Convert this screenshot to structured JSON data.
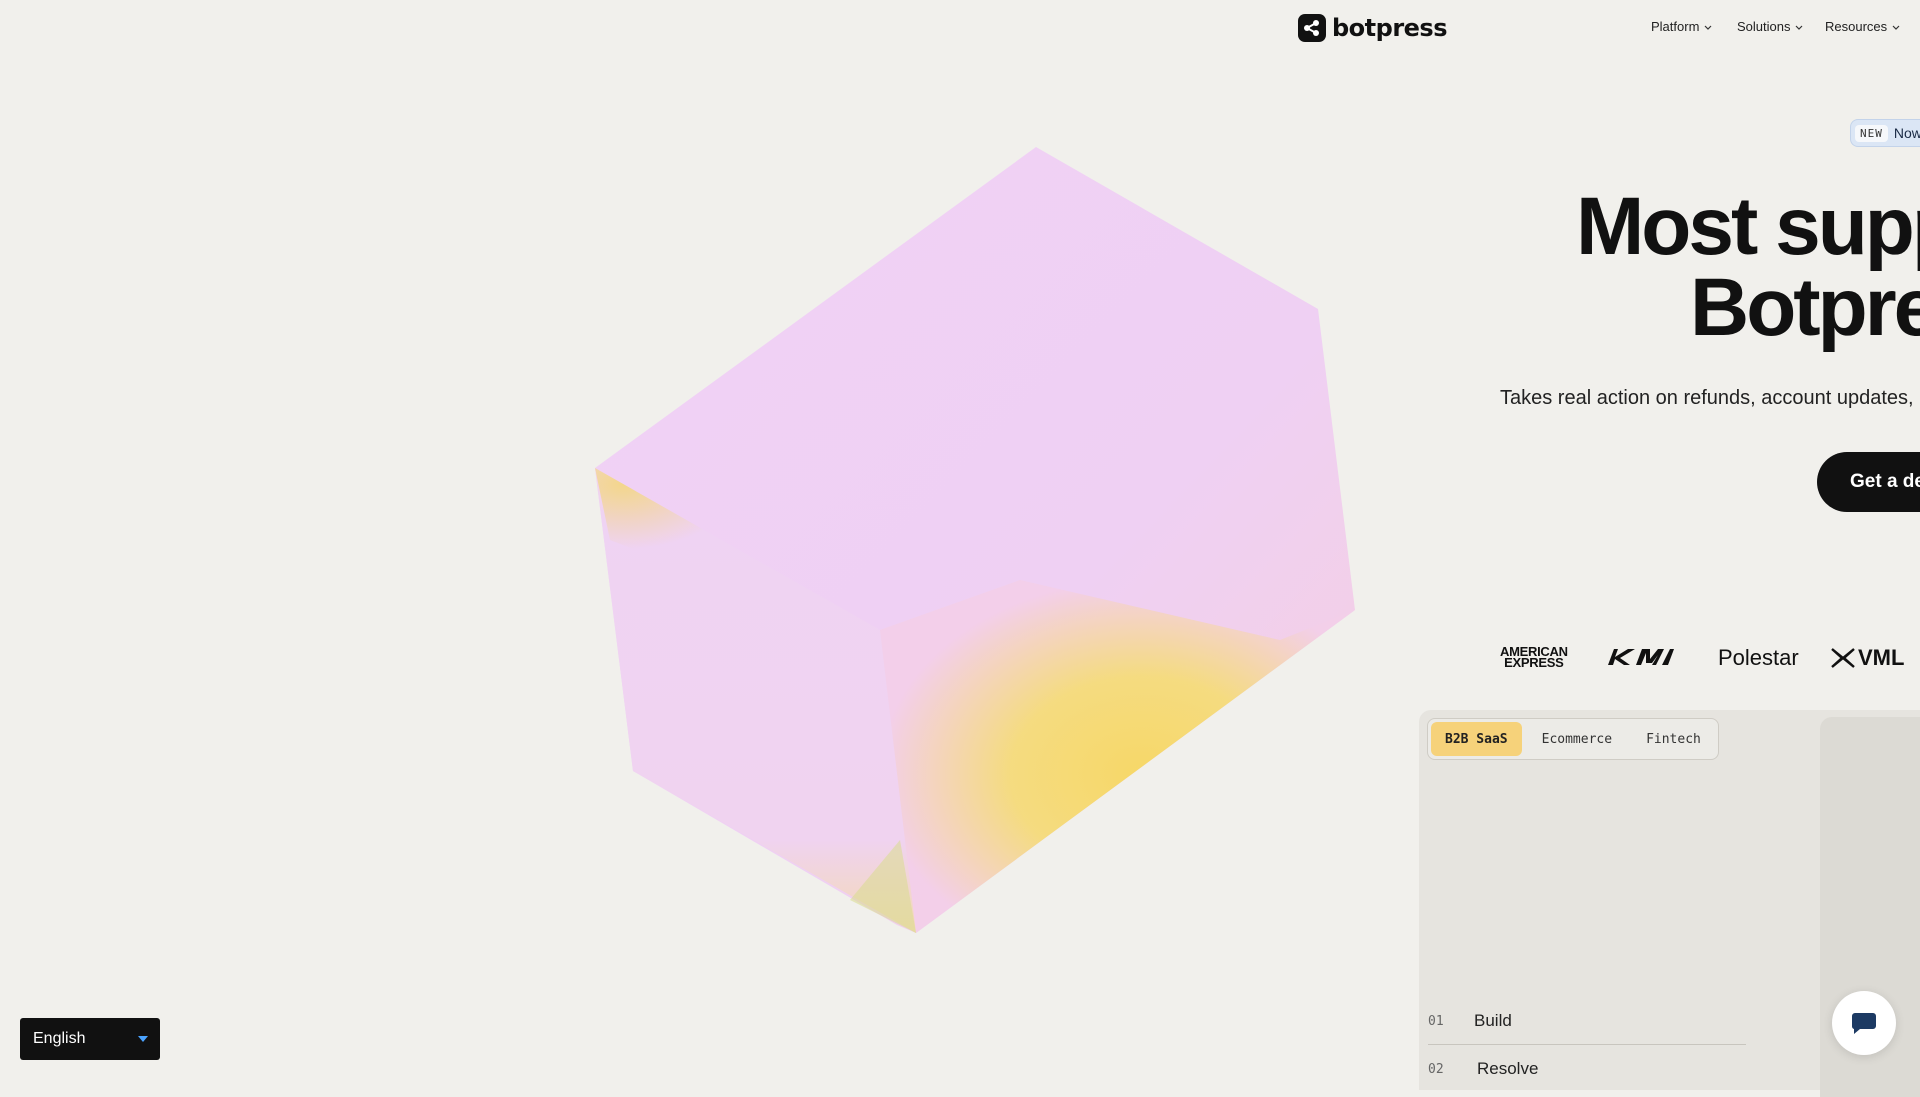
{
  "header": {
    "brand": "botpress",
    "nav": [
      {
        "label": "Platform"
      },
      {
        "label": "Solutions"
      },
      {
        "label": "Resources"
      }
    ]
  },
  "announcement": {
    "tag": "NEW",
    "text": "Now"
  },
  "hero": {
    "title_line1": "Most supp",
    "title_line2": "Botpre",
    "subtitle": "Takes real action on refunds, account updates, ar",
    "cta_label": "Get a de"
  },
  "customers": {
    "amex_line1": "AMERICAN",
    "amex_line2": "EXPRESS",
    "kia": "KIA",
    "polestar": "Polestar",
    "vml": "VML"
  },
  "use_cases": {
    "tabs": [
      {
        "label": "B2B SaaS",
        "active": true
      },
      {
        "label": "Ecommerce",
        "active": false
      },
      {
        "label": "Fintech",
        "active": false
      }
    ],
    "steps": [
      {
        "num": "01",
        "label": "Build"
      },
      {
        "num": "02",
        "label": "Resolve"
      }
    ]
  },
  "language_select": {
    "value": "English"
  },
  "colors": {
    "background": "#f1f0ec",
    "accent_tab": "#f6d27a",
    "cta": "#111111"
  }
}
